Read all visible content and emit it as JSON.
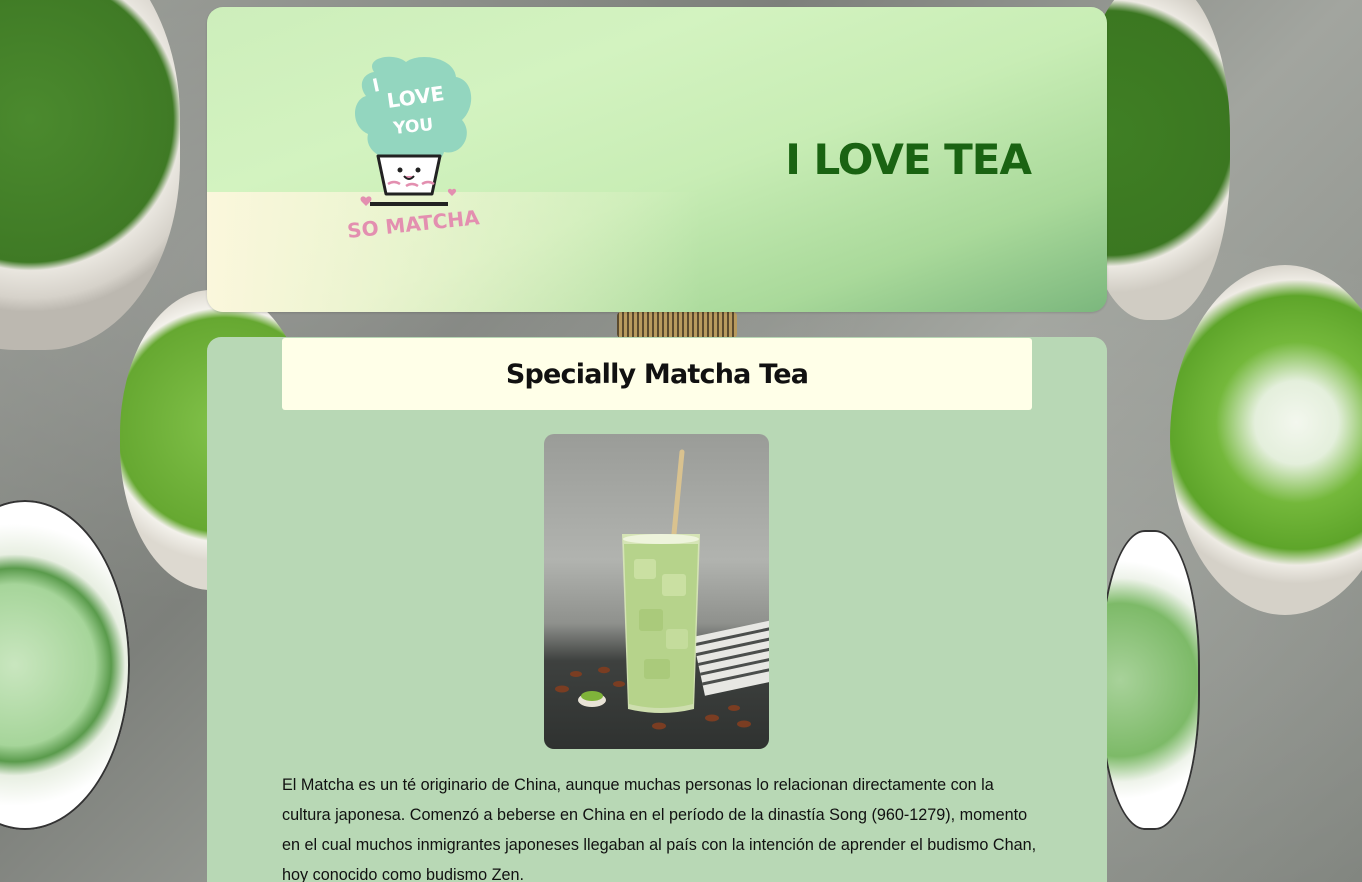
{
  "header": {
    "title": "I LOVE TEA",
    "logo": {
      "icon": "i-love-you-so-matcha-logo-icon",
      "lines": [
        "I",
        "LOVE",
        "YOU",
        "SO MATCHA"
      ]
    }
  },
  "main": {
    "section_title": "Specially Matcha Tea",
    "photo_icon": "iced-matcha-latte-photo",
    "description": "El Matcha es un té originario de China, aunque muchas personas lo relacionan directamente con la cultura japonesa. Comenzó a beberse en China en el período de la dinastía Song (960-1279), momento en el cual muchos inmigrantes japoneses llegaban al país con la intención de aprender el budismo Chan, hoy conocido como budismo Zen."
  },
  "colors": {
    "title_green": "#1a6312",
    "main_card": "#b8d8b5",
    "title_box": "#ffffe8",
    "logo_mint": "#8fd4bf",
    "logo_pink": "#e38fb0"
  }
}
